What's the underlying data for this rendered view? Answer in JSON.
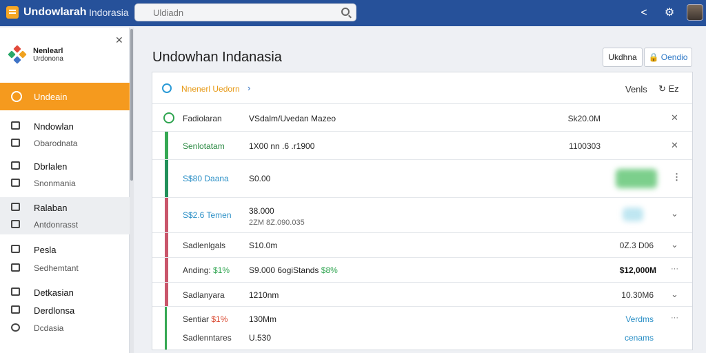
{
  "topbar": {
    "app_title": "Undowlarah",
    "app_subtitle": "Indorasia",
    "search_placeholder": "Uldiadn",
    "icons": [
      "share-icon",
      "gear-icon",
      "user-avatar"
    ]
  },
  "sidebar": {
    "brand_line1": "Nenlearl",
    "brand_line2": "Urdonona",
    "active_item": "Undeain",
    "items": [
      {
        "label": "Nndowlan",
        "sub": false,
        "icon": "tray-icon"
      },
      {
        "label": "Obarodnata",
        "sub": true,
        "icon": "list-icon"
      },
      {
        "label": "Dbrlalen",
        "sub": false,
        "icon": "monitor-icon"
      },
      {
        "label": "Snonmania",
        "sub": true,
        "icon": "pin-icon"
      },
      {
        "label": "Ralaban",
        "sub": false,
        "icon": "chart-icon"
      },
      {
        "label": "Antdonrasst",
        "sub": true,
        "icon": "grid-icon"
      },
      {
        "label": "Pesla",
        "sub": false,
        "icon": "calendar-icon"
      },
      {
        "label": "Sedhemtant",
        "sub": true,
        "icon": "card-icon"
      },
      {
        "label": "Detkasian",
        "sub": false,
        "icon": "flag-icon"
      },
      {
        "label": "Derdlonsa",
        "sub": false,
        "icon": "film-icon"
      },
      {
        "label": "Dcdasia",
        "sub": true,
        "icon": "location-icon"
      }
    ]
  },
  "main": {
    "page_title": "Undowhan Indanasia",
    "btn_secondary": "Ukdhna",
    "btn_primary": "Oendio",
    "panel": {
      "crumb": "Nnenerl Uedorn",
      "ver_label": "Venls",
      "ez_label": "Ez",
      "rows": [
        {
          "c1": "Fadiolaran",
          "c2": "VSdalm/Uvedan Mazeo",
          "c3": "Sk20.0M",
          "act": "✕"
        },
        {
          "c1": "Senlotatam",
          "c2": "1X00 nn .6 .r1900",
          "c3": "1100303",
          "act": "✕"
        },
        {
          "c1": "S$80 Daana",
          "c2": "S0.00",
          "c3": "",
          "act": "⋮"
        },
        {
          "c1": "S$2.6 Temen",
          "c2": "38.000",
          "c2b": "2ZM 8Z.090.035",
          "c3": "",
          "act": "⌄"
        },
        {
          "c1": "Sadlenlgals",
          "c2": "S10.0m",
          "c3": "0Z.3 D06",
          "act": "⌄"
        },
        {
          "c1": "Anding:",
          "c1b": "$1%",
          "c2": "S9.000 6ogiStands",
          "c2b": "$8%",
          "c3": "$12,000M",
          "act": "···"
        },
        {
          "c1": "Sadlanyara",
          "c2": "1210nm",
          "c3": "10.30M6",
          "act": "⌄"
        },
        {
          "c1": "Sentiar",
          "c1b": "$1%",
          "c2": "130Mm",
          "c3": "Verdms",
          "act": "···"
        },
        {
          "c1": "Sadlenntares",
          "c2": "U.530",
          "c3": "cenams",
          "act": ""
        }
      ]
    }
  }
}
